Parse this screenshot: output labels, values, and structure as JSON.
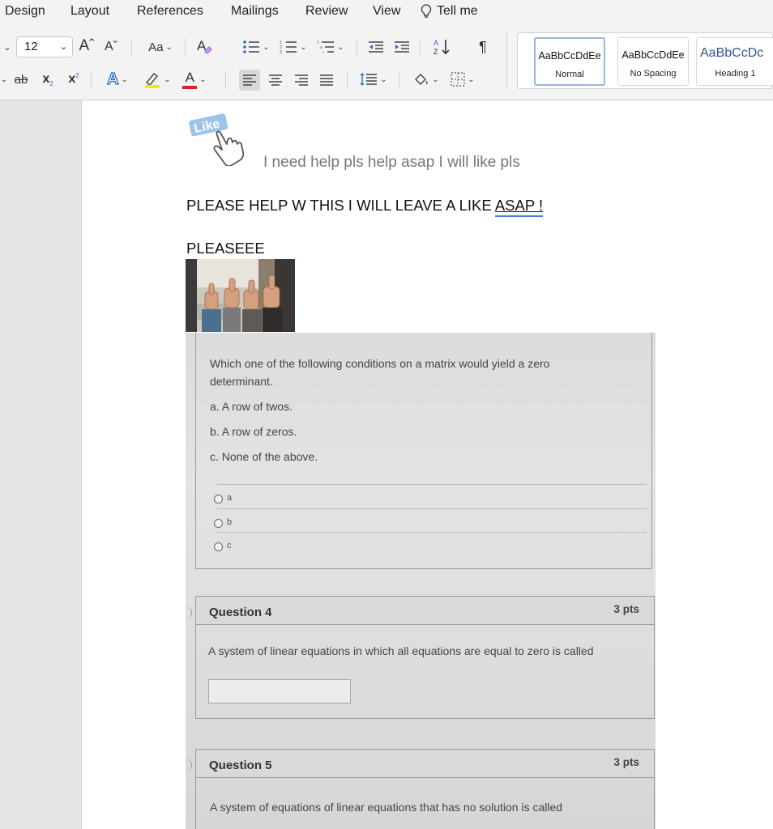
{
  "menu": {
    "design": "Design",
    "layout": "Layout",
    "references": "References",
    "mailings": "Mailings",
    "review": "Review",
    "view": "View",
    "tell_me": "Tell me"
  },
  "ribbon": {
    "font_size": "12",
    "grow_font": "Aˆ",
    "shrink_font": "Aˇ",
    "change_case": "Aa",
    "strikethrough": "ab",
    "subscript": "x",
    "superscript": "x",
    "font_color_letter": "A",
    "text_effects_letter": "A",
    "pilcrow": "¶",
    "highlight_color": "#f5e51b",
    "font_color": "#e02020"
  },
  "styles": [
    {
      "sample": "AaBbCcDdEe",
      "name": "Normal"
    },
    {
      "sample": "AaBbCcDdEe",
      "name": "No Spacing"
    },
    {
      "sample": "AaBbCcDc",
      "name": "Heading 1"
    }
  ],
  "document": {
    "like_logo_text": "Like",
    "note": "I need help pls help asap I will like pls",
    "plea_main": "PLEASE HELP W THIS I WILL LEAVE A LIKE",
    "plea_asap": "ASAP !",
    "pleaseee": "PLEASEEE"
  },
  "quiz": {
    "q3_prompt_line1": "Which one of the following conditions on a matrix would yield a zero",
    "q3_prompt_line2": "determinant.",
    "q3_option_a": "a. A row of twos.",
    "q3_option_b": "b.  A row of zeros.",
    "q3_option_c": "c. None of the above.",
    "q3_radio_labels": [
      "a",
      "b",
      "c"
    ],
    "q4_title": "Question 4",
    "q4_points": "3 pts",
    "q4_text": "A system of linear equations in which all equations are equal to zero is called",
    "q5_title": "Question 5",
    "q5_points": "3 pts",
    "q5_text": "A system of equations of linear equations that has no solution is called"
  }
}
